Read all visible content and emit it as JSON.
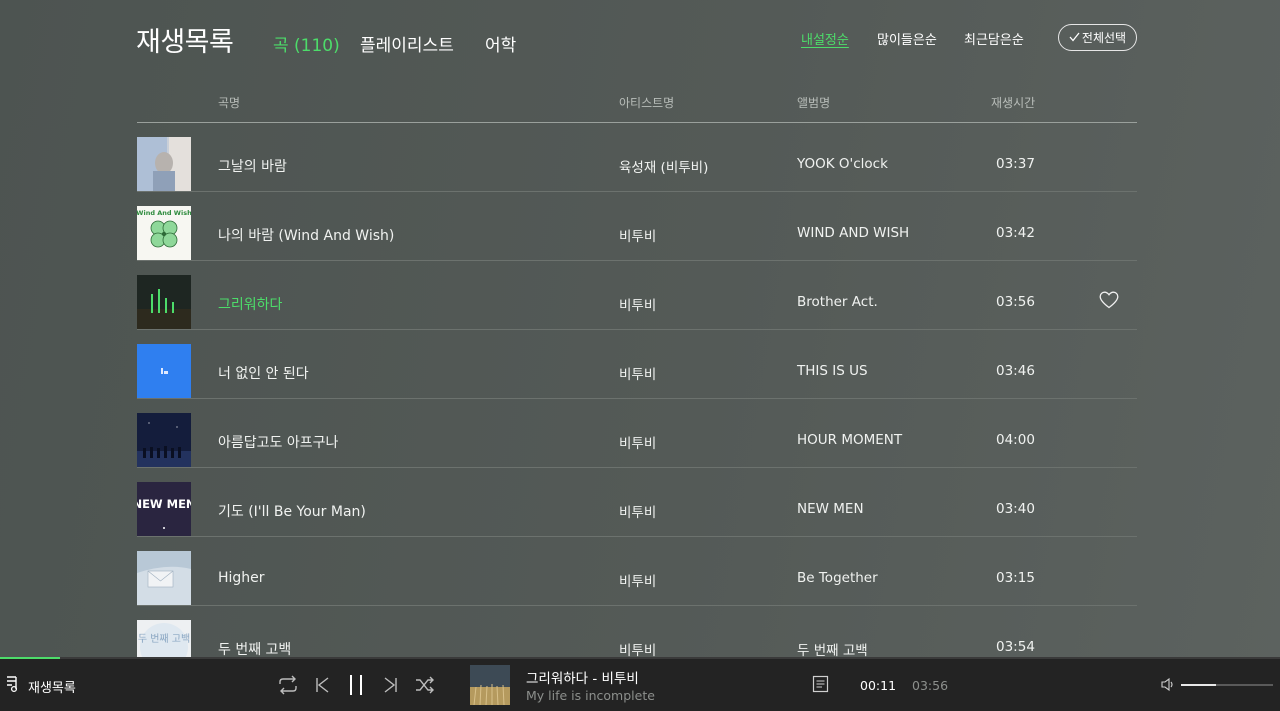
{
  "header": {
    "title": "재생목록",
    "tabs": [
      {
        "label": "곡 (110)",
        "active": true
      },
      {
        "label": "플레이리스트",
        "active": false
      },
      {
        "label": "어학",
        "active": false
      }
    ],
    "sort_options": [
      {
        "label": "내설정순",
        "active": true
      },
      {
        "label": "많이들은순",
        "active": false
      },
      {
        "label": "최근담은순",
        "active": false
      }
    ],
    "select_all_label": "전체선택"
  },
  "columns": {
    "title": "곡명",
    "artist": "아티스트명",
    "album": "앨범명",
    "duration": "재생시간"
  },
  "songs": [
    {
      "title": "그날의 바람",
      "artist": "육성재 (비투비)",
      "album": "YOOK O'clock",
      "duration": "03:37"
    },
    {
      "title": "나의 바람 (Wind And Wish)",
      "artist": "비투비",
      "album": "WIND AND WISH",
      "duration": "03:42",
      "cover_text": "Wind And Wish"
    },
    {
      "title": "그리워하다",
      "artist": "비투비",
      "album": "Brother Act.",
      "duration": "03:56",
      "playing": true
    },
    {
      "title": "너 없인 안 된다",
      "artist": "비투비",
      "album": "THIS IS US",
      "duration": "03:46"
    },
    {
      "title": "아름답고도 아프구나",
      "artist": "비투비",
      "album": "HOUR MOMENT",
      "duration": "04:00"
    },
    {
      "title": "기도 (I'll Be Your Man)",
      "artist": "비투비",
      "album": "NEW MEN",
      "duration": "03:40",
      "cover_text": "NEW MEN"
    },
    {
      "title": "Higher",
      "artist": "비투비",
      "album": "Be Together",
      "duration": "03:15"
    },
    {
      "title": "두 번째 고백",
      "artist": "비투비",
      "album": "두 번째 고백",
      "duration": "03:54",
      "cover_text": "두 번째 고백"
    }
  ],
  "player": {
    "playlist_label": "재생목록",
    "now_playing_title": "그리워하다 - 비투비",
    "now_playing_sub": "My life is incomplete",
    "current_time": "00:11",
    "total_time": "03:56",
    "progress": 0.0466,
    "volume": 0.38
  },
  "colors": {
    "accent": "#4ddc6a",
    "background": "#525855",
    "player_bar": "#232323"
  }
}
